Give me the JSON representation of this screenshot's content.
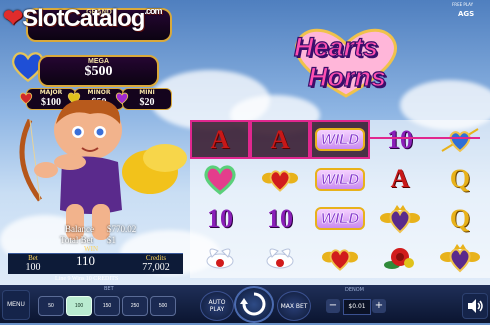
{
  "watermark": {
    "brand": "SlotCatalog",
    "suffix": ".com"
  },
  "jackpots": {
    "grand": {
      "label": "GRAND"
    },
    "mega": {
      "label": "MEGA",
      "value": "$500"
    },
    "minis": [
      {
        "label": "MAJOR",
        "value": "$100",
        "color": "#d12a2a"
      },
      {
        "label": "MINOR",
        "value": "$50",
        "color": "#e0c21b"
      },
      {
        "label": "MINI",
        "value": "$20",
        "color": "#a12ad0"
      }
    ]
  },
  "game": {
    "title_line1": "Hearts",
    "title_line2": "Horns",
    "free_play": "FREE PLAY",
    "provider": "AGS"
  },
  "account": {
    "balance_label": "Balance",
    "balance": "$770.02",
    "total_bet_label": "Total Bet",
    "total_bet": "$1"
  },
  "win_bar": {
    "bet_label": "Bet",
    "bet": "100",
    "win_label": "WIN",
    "win": "110",
    "credits_label": "Credits",
    "credits": "77,002"
  },
  "lines_info": "Line 9 Wins 10 CREDITS",
  "reels": [
    [
      {
        "t": "A",
        "k": "sA",
        "hl": true
      },
      {
        "t": "♥",
        "k": "heart"
      },
      {
        "t": "10",
        "k": "s10"
      },
      {
        "t": "dove",
        "k": "dove"
      }
    ],
    [
      {
        "t": "A",
        "k": "sA",
        "hl": true
      },
      {
        "t": "heart-gold",
        "k": "gheart"
      },
      {
        "t": "10",
        "k": "s10"
      },
      {
        "t": "dove",
        "k": "dove"
      }
    ],
    [
      {
        "t": "WILD",
        "k": "wild",
        "hl": true
      },
      {
        "t": "WILD",
        "k": "wild"
      },
      {
        "t": "WILD",
        "k": "wild"
      },
      {
        "t": "heart-gold",
        "k": "gheart"
      }
    ],
    [
      {
        "t": "10",
        "k": "s10"
      },
      {
        "t": "A",
        "k": "sA"
      },
      {
        "t": "crown",
        "k": "crown"
      },
      {
        "t": "rose",
        "k": "rose"
      }
    ],
    [
      {
        "t": "arrow",
        "k": "arrow"
      },
      {
        "t": "Q",
        "k": "sQ"
      },
      {
        "t": "Q",
        "k": "sQ"
      },
      {
        "t": "crown",
        "k": "crown"
      }
    ]
  ],
  "controls": {
    "menu": "MENU",
    "bet_label": "BET",
    "bet_options": [
      "50",
      "100",
      "150",
      "250",
      "500"
    ],
    "bet_selected": 1,
    "auto_play": "AUTO PLAY",
    "max_bet": "MAX BET",
    "denom_label": "DENOM",
    "denom_value": "$0.01",
    "minus": "−",
    "plus": "+"
  }
}
